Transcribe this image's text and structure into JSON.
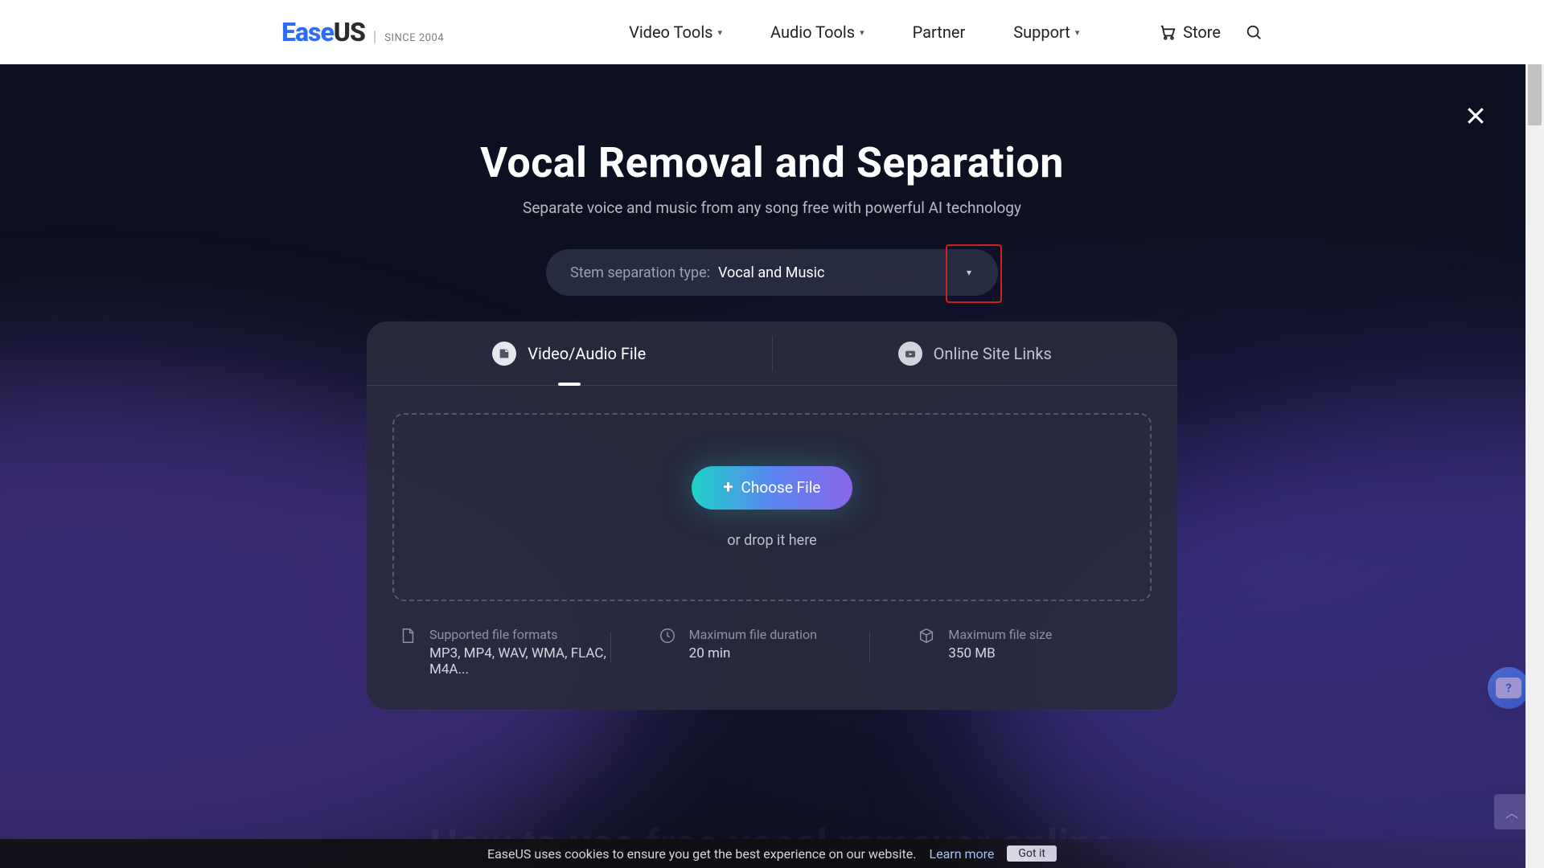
{
  "brand": {
    "ease": "Ease",
    "us": "US",
    "since": "SINCE 2004"
  },
  "nav": {
    "items": [
      {
        "label": "Video Tools",
        "has_dropdown": true
      },
      {
        "label": "Audio Tools",
        "has_dropdown": true
      },
      {
        "label": "Partner",
        "has_dropdown": false
      },
      {
        "label": "Support",
        "has_dropdown": true
      }
    ],
    "store": "Store"
  },
  "hero": {
    "title": "Vocal Removal and Separation",
    "subtitle": "Separate voice and music from any song free with powerful AI technology"
  },
  "stem": {
    "label": "Stem separation type:",
    "value": "Vocal and Music"
  },
  "tabs": {
    "file": "Video/Audio File",
    "links": "Online Site Links"
  },
  "upload": {
    "choose": "Choose File",
    "drop": "or drop it here"
  },
  "specs": {
    "formats_label": "Supported file formats",
    "formats_value": "MP3, MP4, WAV, WMA, FLAC, M4A...",
    "duration_label": "Maximum file duration",
    "duration_value": "20 min",
    "size_label": "Maximum file size",
    "size_value": "350 MB"
  },
  "section2_title": "How to use free vocal remover online",
  "cookie": {
    "message": "EaseUS uses cookies to ensure you get the best experience on our website.",
    "learn_more": "Learn more",
    "accept": "Got it"
  }
}
